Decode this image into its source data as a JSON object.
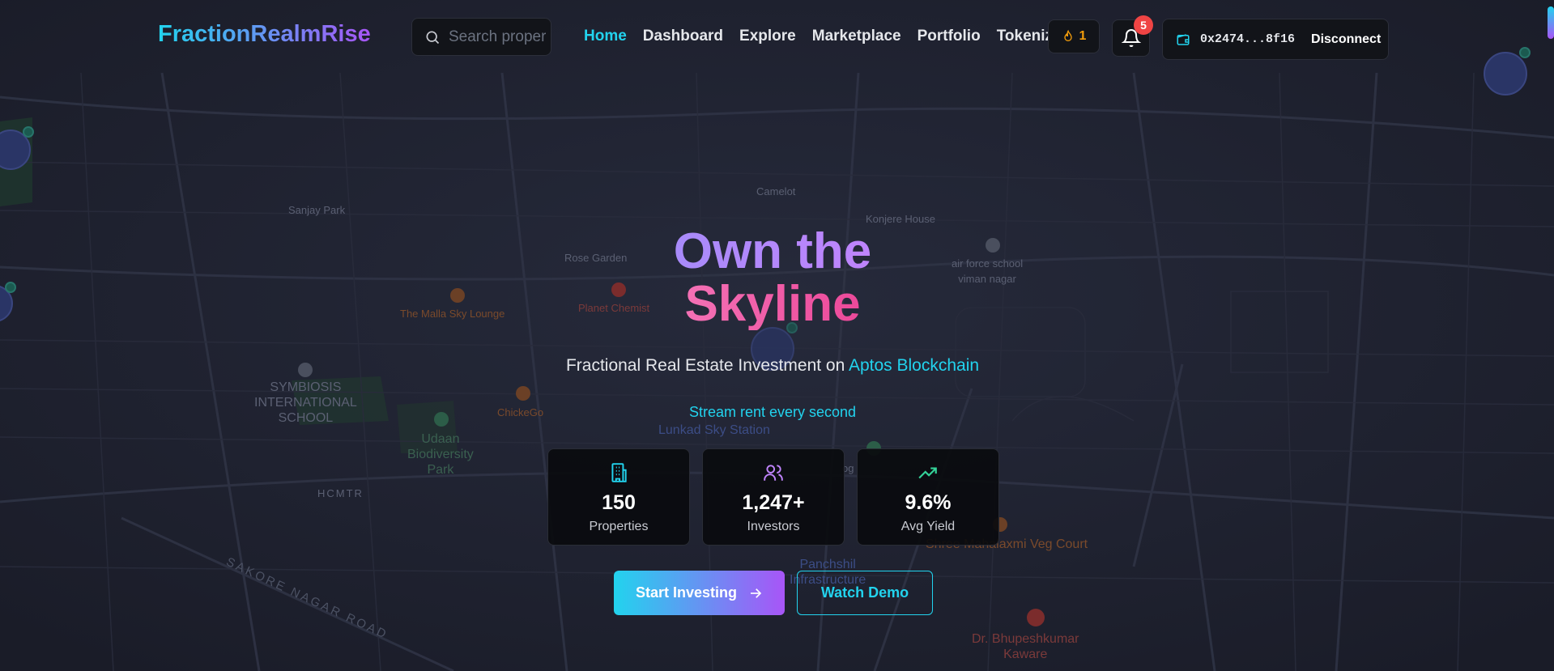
{
  "header": {
    "brand": "FractionRealmRise",
    "search_placeholder": "Search properties...",
    "nav": [
      {
        "label": "Home"
      },
      {
        "label": "Dashboard"
      },
      {
        "label": "Explore"
      },
      {
        "label": "Marketplace"
      },
      {
        "label": "Portfolio"
      },
      {
        "label": "Tokenize"
      }
    ],
    "streak_count": "1",
    "notification_count": "5",
    "wallet_address": "0x2474...8f16",
    "disconnect_label": "Disconnect"
  },
  "hero": {
    "title_line1": "Own the",
    "title_line2": "Skyline",
    "subtitle_prefix": "Fractional Real Estate Investment on",
    "subtitle_highlight": "Aptos Blockchain",
    "tagline": "Stream rent every second"
  },
  "stats": [
    {
      "icon": "building-icon",
      "value": "150",
      "label": "Properties",
      "color": "#22d3ee"
    },
    {
      "icon": "users-icon",
      "value": "1,247+",
      "label": "Investors",
      "color": "#c084fc"
    },
    {
      "icon": "trending-up-icon",
      "value": "9.6%",
      "label": "Avg Yield",
      "color": "#34d399"
    }
  ],
  "buttons": {
    "start_label": "Start Investing",
    "demo_label": "Watch Demo"
  },
  "map_labels": {
    "sanjay_park": "Sanjay Park",
    "camelot": "Camelot",
    "konjere": "Konjere House",
    "rose_garden": "Rose Garden",
    "air_force_1": "air force school",
    "air_force_2": "viman nagar",
    "malla": "The Malla Sky Lounge",
    "planet_chemist": "Planet Chemist",
    "symbiosis_1": "SYMBIOSIS",
    "symbiosis_2": "INTERNATIONAL",
    "symbiosis_3": "SCHOOL",
    "chickego": "ChickeGo",
    "lunkad": "Lunkad Sky Station",
    "udaan_1": "Udaan",
    "udaan_2": "Biodiversity",
    "udaan_3": "Park",
    "hcmtr": "HCMTR",
    "sakore": "SAKORE NAGAR ROAD",
    "shree": "Shree Mahalaxmi Veg Court",
    "panchshil_1": "Panchshil",
    "panchshil_2": "Infrastructure",
    "doctor_1": "Dr. Bhupeshkumar",
    "doctor_2": "Kaware",
    "partial_g": "og"
  },
  "colors": {
    "accent_cyan": "#22d3ee",
    "accent_purple": "#a855f7",
    "accent_pink": "#ec4899",
    "badge_red": "#ef4444",
    "streak_orange": "#f59e0b"
  }
}
